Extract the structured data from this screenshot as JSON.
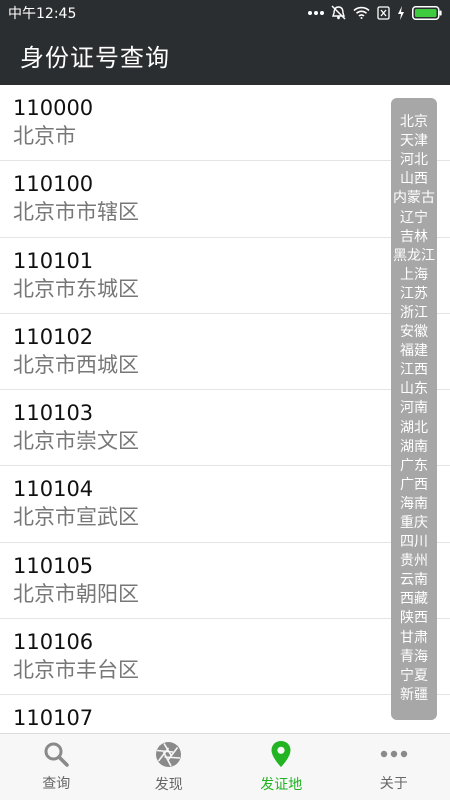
{
  "status_bar": {
    "time": "中午12:45"
  },
  "app_bar": {
    "title": "身份证号查询"
  },
  "list": [
    {
      "code": "110000",
      "area": "北京市"
    },
    {
      "code": "110100",
      "area": "北京市市辖区"
    },
    {
      "code": "110101",
      "area": "北京市东城区"
    },
    {
      "code": "110102",
      "area": "北京市西城区"
    },
    {
      "code": "110103",
      "area": "北京市崇文区"
    },
    {
      "code": "110104",
      "area": "北京市宣武区"
    },
    {
      "code": "110105",
      "area": "北京市朝阳区"
    },
    {
      "code": "110106",
      "area": "北京市丰台区"
    },
    {
      "code": "110107",
      "area": ""
    }
  ],
  "index_bar": [
    "北京",
    "天津",
    "河北",
    "山西",
    "内蒙古",
    "辽宁",
    "吉林",
    "黑龙江",
    "上海",
    "江苏",
    "浙江",
    "安徽",
    "福建",
    "江西",
    "山东",
    "河南",
    "湖北",
    "湖南",
    "广东",
    "广西",
    "海南",
    "重庆",
    "四川",
    "贵州",
    "云南",
    "西藏",
    "陕西",
    "甘肃",
    "青海",
    "宁夏",
    "新疆"
  ],
  "tabs": [
    {
      "label": "查询",
      "icon": "search-icon"
    },
    {
      "label": "发现",
      "icon": "aperture-icon"
    },
    {
      "label": "发证地",
      "icon": "location-pin-icon",
      "active": true
    },
    {
      "label": "关于",
      "icon": "more-dots-icon"
    }
  ],
  "colors": {
    "bar_bg": "#2b2e31",
    "active_tab": "#22b422",
    "battery": "#3fcb3f",
    "index_bg": "#a7a7a7"
  }
}
